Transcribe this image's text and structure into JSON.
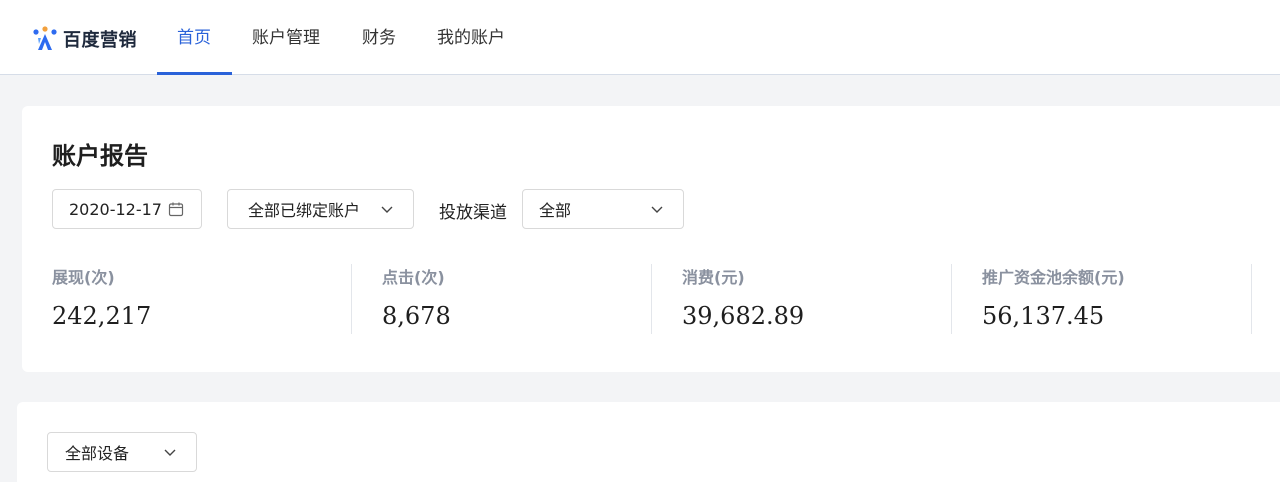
{
  "brand": {
    "name": "百度营销"
  },
  "nav": {
    "items": [
      {
        "label": "首页",
        "active": true
      },
      {
        "label": "账户管理",
        "active": false
      },
      {
        "label": "财务",
        "active": false
      },
      {
        "label": "我的账户",
        "active": false
      }
    ]
  },
  "report": {
    "title": "账户报告",
    "date_value": "2020-12-17",
    "account_select": "全部已绑定账户",
    "channel_label": "投放渠道",
    "channel_select": "全部",
    "metrics": [
      {
        "label": "展现(次)",
        "value": "242,217"
      },
      {
        "label": "点击(次)",
        "value": "8,678"
      },
      {
        "label": "消费(元)",
        "value": "39,682.89"
      },
      {
        "label": "推广资金池余额(元)",
        "value": "56,137.45"
      }
    ]
  },
  "device": {
    "select": "全部设备"
  },
  "colors": {
    "accent": "#2a62d9",
    "background": "#f3f4f6",
    "muted_label": "#8a919f"
  }
}
